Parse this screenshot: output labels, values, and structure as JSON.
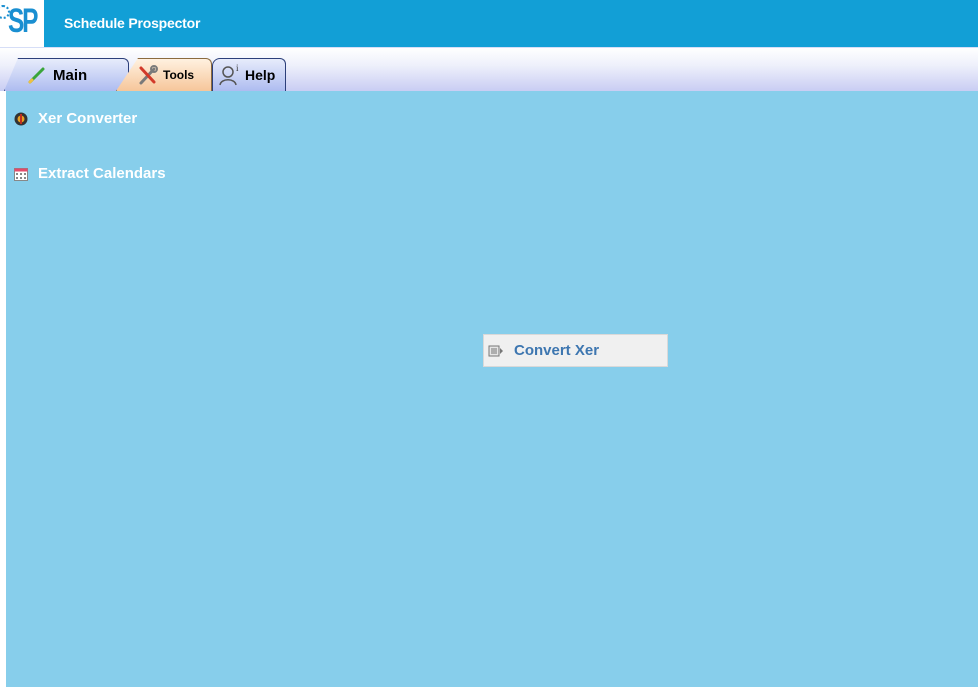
{
  "app": {
    "logo_text": "SP",
    "title": "Schedule Prospector"
  },
  "tabs": [
    {
      "label": "Main",
      "icon": "pencil-icon",
      "selected": false
    },
    {
      "label": "Tools",
      "icon": "tools-icon",
      "selected": true
    },
    {
      "label": "Help",
      "icon": "help-person-icon",
      "selected": false
    }
  ],
  "sidebar": {
    "items": [
      {
        "label": "Xer Converter",
        "icon": "converter-icon"
      },
      {
        "label": "Extract Calendars",
        "icon": "calendar-icon"
      }
    ]
  },
  "main": {
    "convert_button": {
      "label": "Convert Xer",
      "icon": "convert-file-icon"
    }
  },
  "colors": {
    "titlebar": "#129fd6",
    "content_bg": "#87ceeb",
    "button_text": "#3d76b0",
    "tools_tab": "#f6c69a"
  }
}
